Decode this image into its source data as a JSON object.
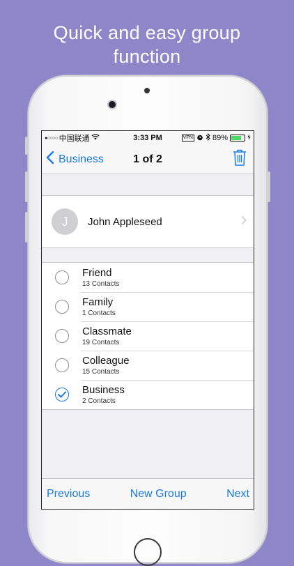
{
  "headline": {
    "line1": "Quick and easy group",
    "line2": "function"
  },
  "statusbar": {
    "signal": "●○○○○",
    "carrier": "中国联通",
    "time": "3:33 PM",
    "vpn": "VPN",
    "battery_percent": "89%",
    "battery_level": 0.89
  },
  "navbar": {
    "back_label": "Business",
    "title": "1 of 2"
  },
  "contact": {
    "initial": "J",
    "name": "John Appleseed"
  },
  "groups": [
    {
      "name": "Friend",
      "count": "13 Contacts",
      "checked": false
    },
    {
      "name": "Family",
      "count": "1 Contacts",
      "checked": false
    },
    {
      "name": "Classmate",
      "count": "19 Contacts",
      "checked": false
    },
    {
      "name": "Colleague",
      "count": "15 Contacts",
      "checked": false
    },
    {
      "name": "Business",
      "count": "2 Contacts",
      "checked": true
    }
  ],
  "toolbar": {
    "previous": "Previous",
    "new_group": "New Group",
    "next": "Next"
  },
  "colors": {
    "accent": "#1a7ae0",
    "background": "#8d86c8",
    "battery": "#4cd964"
  }
}
